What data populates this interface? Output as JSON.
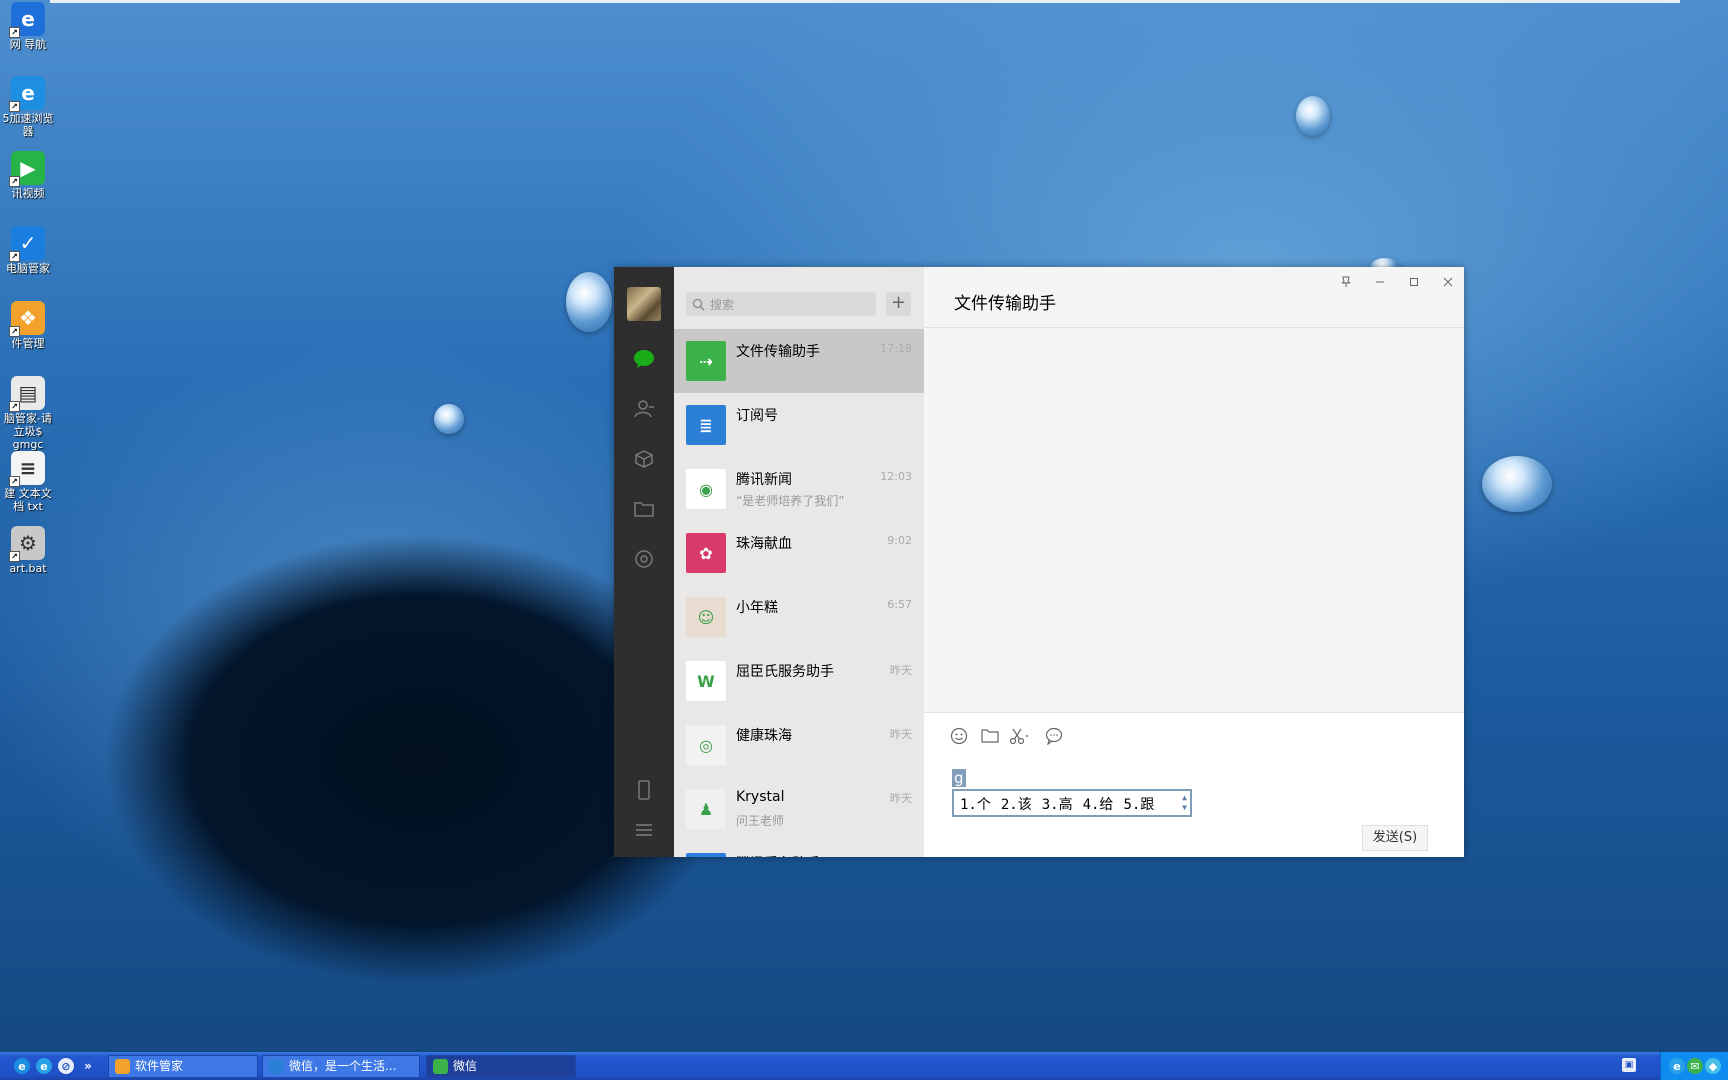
{
  "desktop": {
    "icons": [
      {
        "label": "网 导航",
        "icon": "ie-icon",
        "color": "#1e6fd9",
        "glyph": "e"
      },
      {
        "label": "5加速浏览\n器",
        "icon": "browser-icon",
        "color": "#1e8fe0",
        "glyph": "e"
      },
      {
        "label": "讯视频",
        "icon": "video-icon",
        "color": "#26b34a",
        "glyph": "▶"
      },
      {
        "label": "电脑管家",
        "icon": "shield-icon",
        "color": "#1a7ee0",
        "glyph": "✓"
      },
      {
        "label": "件管理",
        "icon": "app-manager-icon",
        "color": "#f2a22a",
        "glyph": "❖"
      },
      {
        "label": "脑管家-请\n立圾$ gmgc",
        "icon": "document-icon",
        "color": "#e9e9e9",
        "glyph": "▤"
      },
      {
        "label": "建 文本文\n档 txt",
        "icon": "text-file-icon",
        "color": "#f4f4f4",
        "glyph": "≡"
      },
      {
        "label": "art.bat",
        "icon": "bat-file-icon",
        "color": "#c8c8c8",
        "glyph": "⚙"
      }
    ]
  },
  "wechat": {
    "search_placeholder": "搜索",
    "add_label": "+",
    "chats": [
      {
        "name": "文件传输助手",
        "time": "17:18",
        "sub": "",
        "avatar_color": "#3cb34a",
        "avatar_glyph": "⇢",
        "active": true
      },
      {
        "name": "订阅号",
        "time": "",
        "sub": "",
        "avatar_color": "#2c7fd6",
        "avatar_glyph": "≣",
        "active": false
      },
      {
        "name": "腾讯新闻",
        "time": "12:03",
        "sub": "“是老师培养了我们”",
        "avatar_color": "#ffffff",
        "avatar_glyph": "◉",
        "active": false
      },
      {
        "name": "珠海献血",
        "time": "9:02",
        "sub": "",
        "avatar_color": "#d83a6b",
        "avatar_glyph": "✿",
        "active": false
      },
      {
        "name": "小年糕",
        "time": "6:57",
        "sub": "",
        "avatar_color": "#e8dcd0",
        "avatar_glyph": "☺",
        "active": false
      },
      {
        "name": "屈臣氏服务助手",
        "time": "昨天",
        "sub": "",
        "avatar_color": "#ffffff",
        "avatar_glyph": "W",
        "active": false
      },
      {
        "name": "健康珠海",
        "time": "昨天",
        "sub": "",
        "avatar_color": "#f2f2f2",
        "avatar_glyph": "◎",
        "active": false
      },
      {
        "name": "Krystal",
        "time": "昨天",
        "sub": "问王老师",
        "avatar_color": "#f0f0f0",
        "avatar_glyph": "♟",
        "active": false
      },
      {
        "name": "腾讯看车助手",
        "time": "昨天",
        "sub": "",
        "avatar_color": "#2b7de0",
        "avatar_glyph": "◆",
        "active": false
      }
    ],
    "title": "文件传输助手",
    "composer": {
      "typed_text": "g",
      "ime_candidates": [
        "1.个",
        "2.该",
        "3.高",
        "4.给",
        "5.跟"
      ],
      "send_label": "发送(S)"
    }
  },
  "taskbar": {
    "buttons": [
      {
        "label": "软件管家",
        "icon_color": "#f2a22a",
        "active": false
      },
      {
        "label": "微信，是一个生活...",
        "icon_color": "#2c7fd6",
        "active": false
      },
      {
        "label": "微信",
        "icon_color": "#3cb34a",
        "active": true
      }
    ]
  }
}
